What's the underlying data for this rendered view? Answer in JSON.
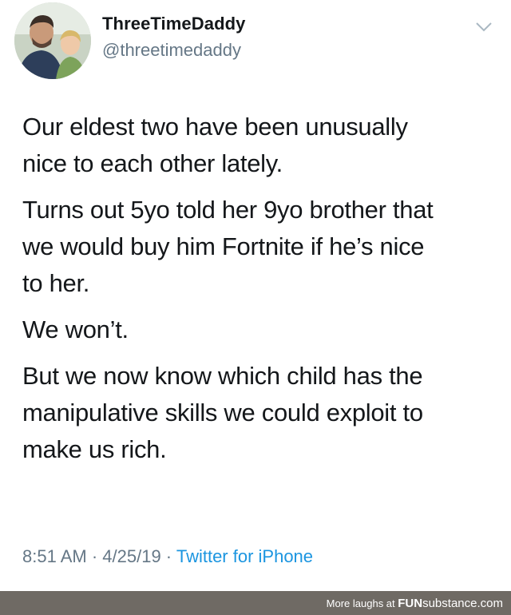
{
  "tweet": {
    "display_name": "ThreeTimeDaddy",
    "handle": "@threetimedaddy",
    "avatar_icon": "profile-photo-icon",
    "menu_icon": "chevron-down-icon",
    "paragraphs": [
      "Our eldest two have been unusually\nnice to each other lately.",
      "Turns out 5yo told her 9yo brother that\nwe would buy him Fortnite if he’s nice\nto her.",
      "We won’t.",
      "But we now know which child has the\nmanipulative skills we could exploit to\nmake us rich."
    ],
    "time": "8:51 AM",
    "date": "4/25/19",
    "separator_1": " · ",
    "separator_2": " · ",
    "source": "Twitter for iPhone"
  },
  "footer": {
    "text": "More laughs at ",
    "logo_part_1": "FUN",
    "logo_part_2": "substance",
    "logo_part_3": ".com"
  },
  "colors": {
    "link": "#1b95e0",
    "muted": "#657786",
    "text": "#14171a",
    "footer_bg": "#6f6a64"
  }
}
